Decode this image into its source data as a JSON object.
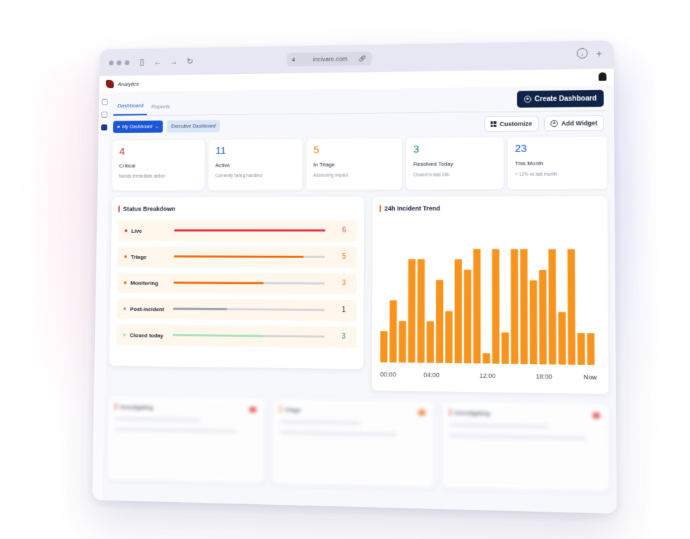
{
  "browser": {
    "url": "incivare.com"
  },
  "app": {
    "title": "Analytics"
  },
  "tabs": [
    {
      "label": "Dashboard",
      "active": true
    },
    {
      "label": "Reports",
      "active": false
    }
  ],
  "create_button": "Create Dashboard",
  "toolbar": {
    "my_dashboard": "My Dashboard",
    "executive": "Executive Dashboard",
    "customize": "Customize",
    "add_widget": "Add Widget"
  },
  "stats": [
    {
      "value": "4",
      "label": "Critical",
      "sub": "Needs immediate action",
      "color": "#d62b2b"
    },
    {
      "value": "11",
      "label": "Active",
      "sub": "Currently being handled",
      "color": "#1a56d6"
    },
    {
      "value": "5",
      "label": "In Triage",
      "sub": "Assessing impact",
      "color": "#d9860c"
    },
    {
      "value": "3",
      "label": "Resolved Today",
      "sub": "Closed in last 24h",
      "color": "#1e8f4a"
    },
    {
      "value": "23",
      "label": "This Month",
      "sub": "+ 12% vs last month",
      "color": "#1a56d6"
    }
  ],
  "status_breakdown": {
    "title": "Status Breakdown",
    "accent": "#e03131",
    "rows": [
      {
        "label": "Live",
        "count": "6",
        "fraction": 1.0,
        "color": "#e6323c",
        "count_color": "#e6323c"
      },
      {
        "label": "Triage",
        "count": "5",
        "fraction": 0.86,
        "color": "#f07010",
        "count_color": "#e0700f"
      },
      {
        "label": "Monitoring",
        "count": "3",
        "fraction": 0.6,
        "color": "#f07010",
        "count_color": "#e0700f"
      },
      {
        "label": "Post-incident",
        "count": "1",
        "fraction": 0.36,
        "color": "#9ca0aa",
        "count_color": "#333333"
      },
      {
        "label": "Closed today",
        "count": "3",
        "fraction": 0.6,
        "color": "#a6e2bc",
        "count_color": "#1e8f4a"
      }
    ]
  },
  "chart_data": {
    "type": "bar",
    "title": "24h Incident Trend",
    "accent": "#f07010",
    "bar_color": "#f7941d",
    "x_ticks": [
      "00:00",
      "04:00",
      "12:00",
      "18:00",
      "Now"
    ],
    "values": [
      3,
      6,
      4,
      10,
      10,
      4,
      8,
      5,
      10,
      9,
      11,
      1,
      11,
      3,
      11,
      11,
      8,
      9,
      11,
      5,
      11,
      3,
      3
    ],
    "ylim": [
      0,
      12
    ]
  },
  "lower_cards": [
    {
      "title": "Investigating",
      "accent": "#e03131"
    },
    {
      "title": "Triage",
      "accent": "#f07010"
    },
    {
      "title": "Investigating",
      "accent": "#e03131"
    }
  ]
}
